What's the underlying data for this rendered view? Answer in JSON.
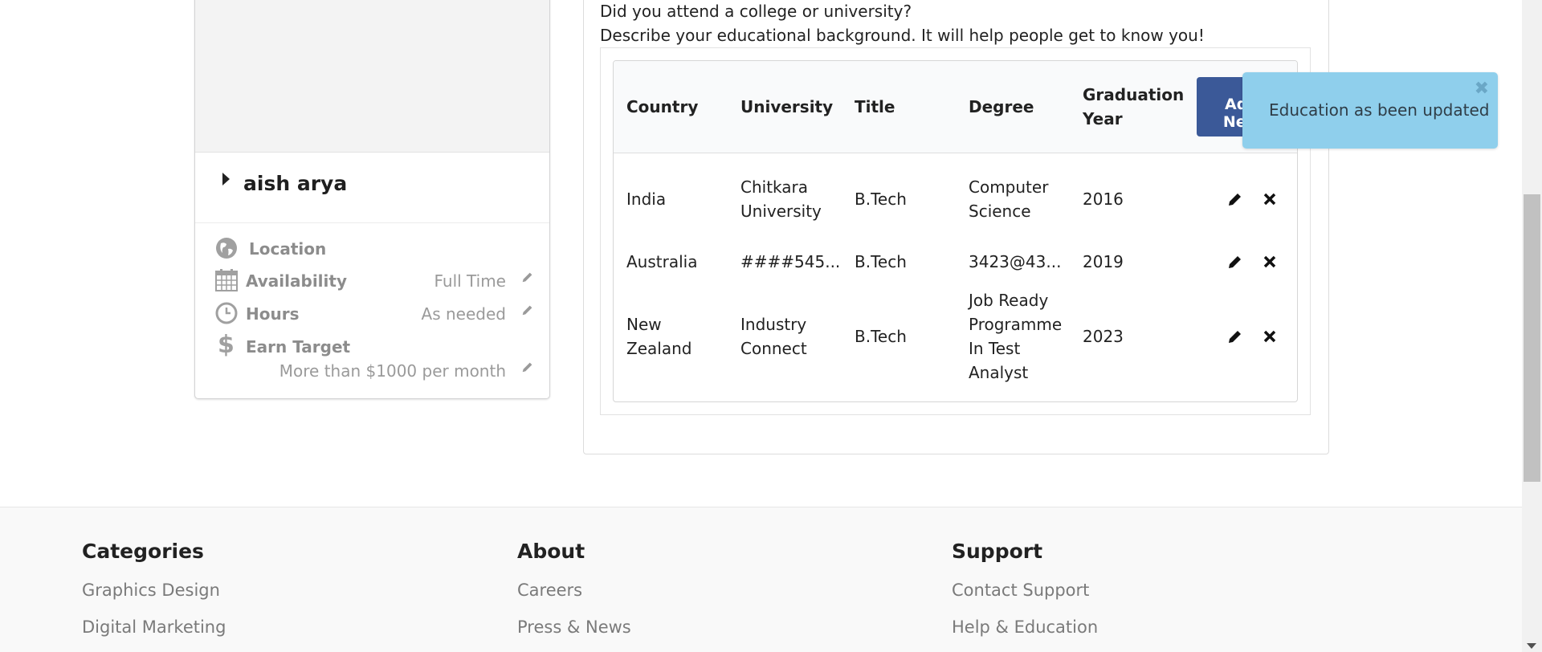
{
  "profile": {
    "name": "aish arya",
    "details": {
      "location_label": "Location",
      "availability_label": "Availability",
      "availability_value": "Full Time",
      "hours_label": "Hours",
      "hours_value": "As needed",
      "earn_label": "Earn Target",
      "earn_value": "More than $1000 per month"
    }
  },
  "education": {
    "question": "Did you attend a college or university?",
    "description": "Describe your educational background. It will help people get to know you!",
    "headers": {
      "country": "Country",
      "university": "University",
      "title": "Title",
      "degree": "Degree",
      "year_line1": "Graduation",
      "year_line2": "Year"
    },
    "add_label_line1": "Add",
    "add_label_line2": "New",
    "rows": [
      {
        "country": "India",
        "university_line1": "Chitkara",
        "university_line2": "University",
        "title": "B.Tech",
        "degree_line1": "Computer",
        "degree_line2": "Science",
        "year": "2016"
      },
      {
        "country": "Australia",
        "university": "####545...",
        "title": "B.Tech",
        "degree": "3423@43...",
        "year": "2019"
      },
      {
        "country_line1": "New",
        "country_line2": "Zealand",
        "university_line1": "Industry",
        "university_line2": "Connect",
        "title": "B.Tech",
        "degree_line1": "Job Ready",
        "degree_line2": "Programme",
        "degree_line3": "In Test",
        "degree_line4": "Analyst",
        "year": "2023"
      }
    ]
  },
  "toast": {
    "message": "Education as been updated",
    "close": "✖"
  },
  "footer": {
    "categories": {
      "heading": "Categories",
      "links": [
        "Graphics Design",
        "Digital Marketing"
      ]
    },
    "about": {
      "heading": "About",
      "links": [
        "Careers",
        "Press & News"
      ]
    },
    "support": {
      "heading": "Support",
      "links": [
        "Contact Support",
        "Help & Education"
      ]
    }
  },
  "colors": {
    "primary_button": "#3b5998",
    "toast_bg": "#8fcfec",
    "footer_bg": "#f9f9f9"
  }
}
